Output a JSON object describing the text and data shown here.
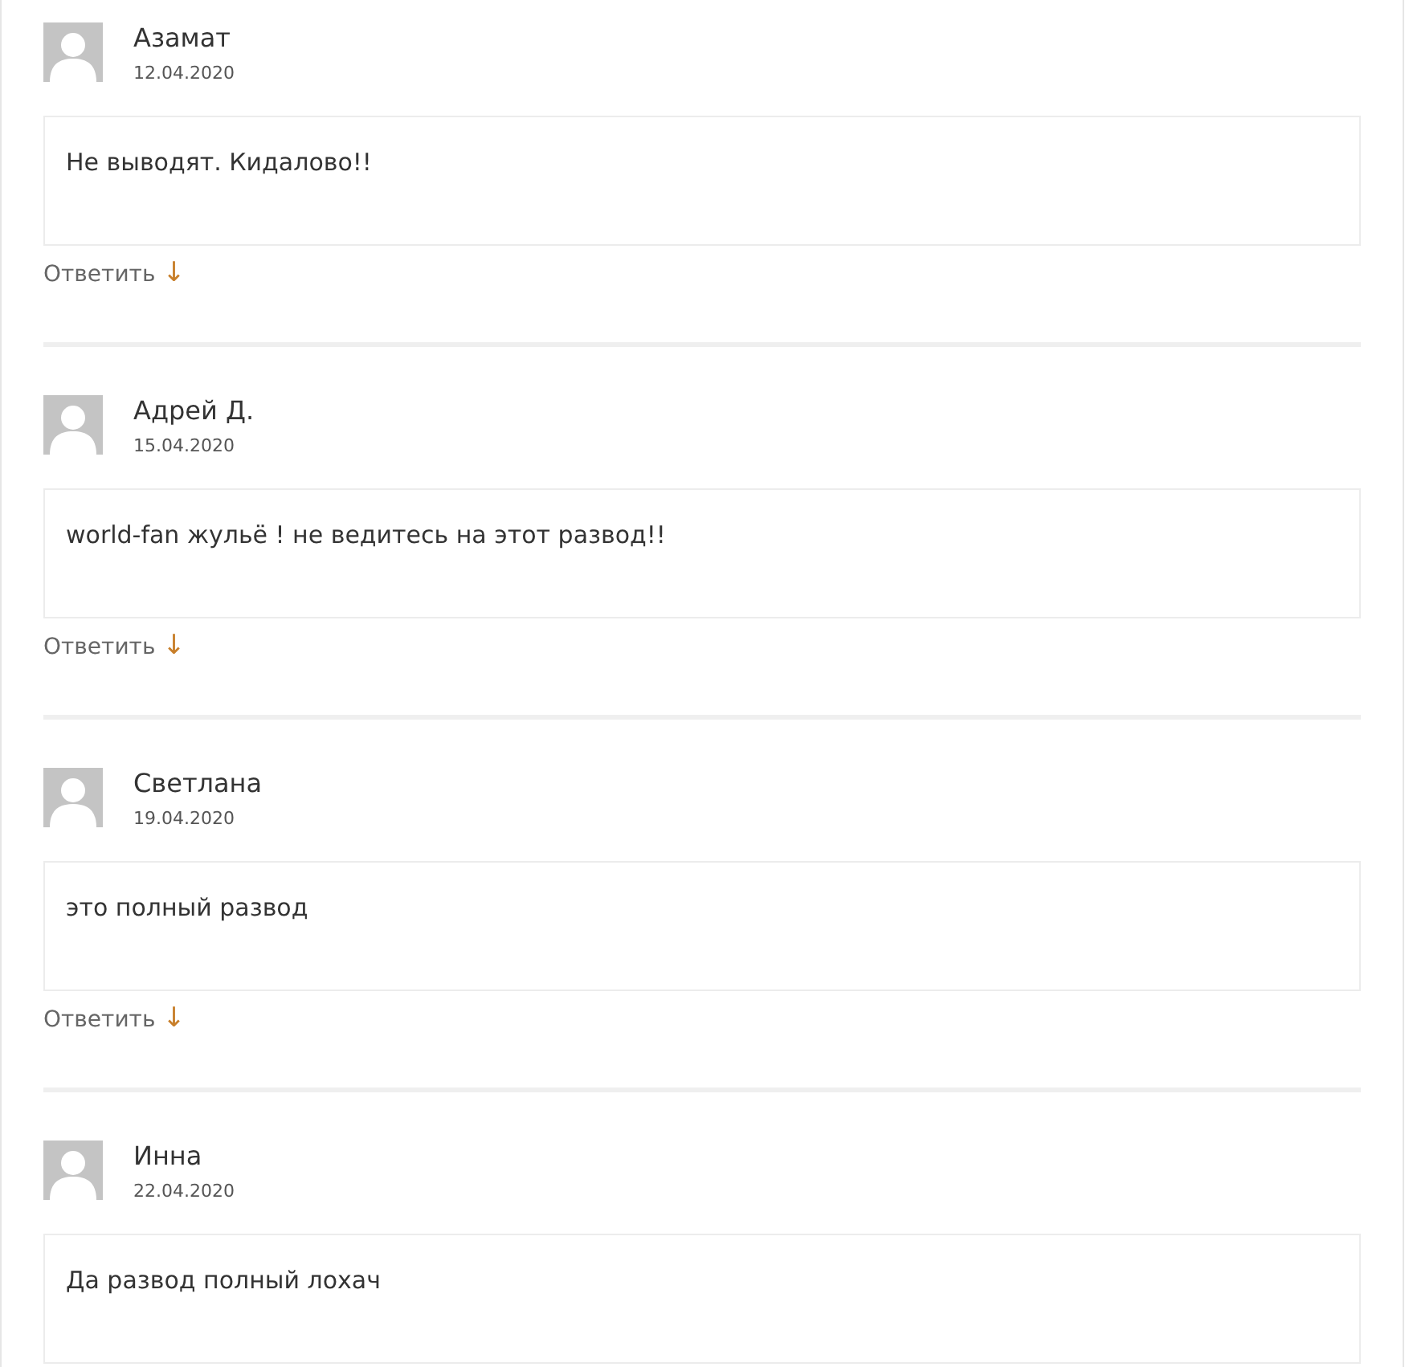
{
  "comments": [
    {
      "author": "Азамат",
      "date": "12.04.2020",
      "text": "Не выводят. Кидалово!!",
      "reply_label": "Ответить",
      "reply_arrow": "↓"
    },
    {
      "author": "Адрей Д.",
      "date": "15.04.2020",
      "text": "world-fan жульё ! не ведитесь на этот развод!!",
      "reply_label": "Ответить",
      "reply_arrow": "↓"
    },
    {
      "author": "Светлана",
      "date": "19.04.2020",
      "text": "это полный развод",
      "reply_label": "Ответить",
      "reply_arrow": "↓"
    },
    {
      "author": "Инна",
      "date": "22.04.2020",
      "text": "Да развод полный лохач"
    }
  ]
}
